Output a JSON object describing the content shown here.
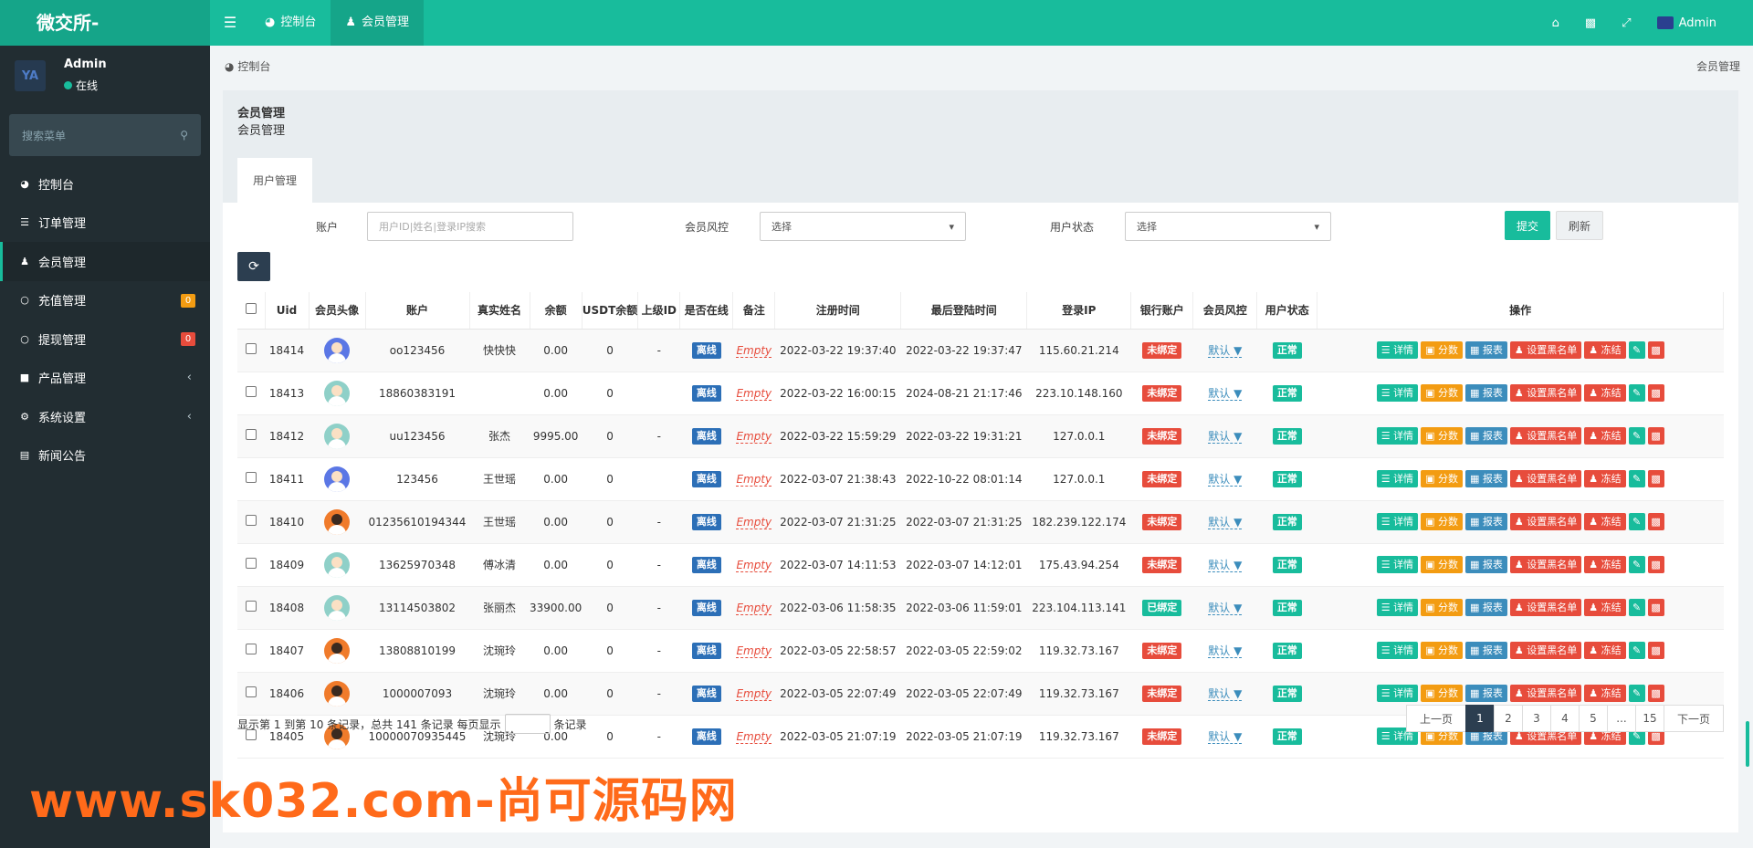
{
  "app": {
    "logo": "微交所-"
  },
  "topnav": {
    "dashboard": "控制台",
    "members": "会员管理"
  },
  "topright": {
    "user": "Admin"
  },
  "sidebar": {
    "user": {
      "name": "Admin",
      "status": "在线",
      "avatar_text": "YA"
    },
    "search_placeholder": "搜索菜单",
    "items": [
      {
        "label": "控制台",
        "icon": "dashboard-icon"
      },
      {
        "label": "订单管理",
        "icon": "list-icon"
      },
      {
        "label": "会员管理",
        "icon": "users-icon"
      },
      {
        "label": "充值管理",
        "icon": "recharge-icon",
        "badge": "0"
      },
      {
        "label": "提现管理",
        "icon": "withdraw-icon",
        "badge": "0"
      },
      {
        "label": "产品管理",
        "icon": "product-icon"
      },
      {
        "label": "系统设置",
        "icon": "settings-icon"
      },
      {
        "label": "新闻公告",
        "icon": "news-icon"
      }
    ]
  },
  "breadcrumb": {
    "left": "控制台",
    "right": "会员管理"
  },
  "panel": {
    "title": "会员管理",
    "subtitle": "会员管理",
    "tab": "用户管理"
  },
  "filters": {
    "account_label": "账户",
    "account_placeholder": "用户ID|姓名|登录IP搜索",
    "risk_label": "会员风控",
    "risk_value": "选择",
    "status_label": "用户状态",
    "status_value": "选择",
    "submit": "提交",
    "refresh": "刷新"
  },
  "table": {
    "headers": [
      "Uid",
      "会员头像",
      "账户",
      "真实姓名",
      "余额",
      "USDT余额",
      "上级ID",
      "是否在线",
      "备注",
      "注册时间",
      "最后登陆时间",
      "登录IP",
      "银行账户",
      "会员风控",
      "用户状态",
      "操作"
    ],
    "rows": [
      {
        "uid": "18414",
        "avatar": "blue",
        "account": "oo123456",
        "name": "快快快",
        "balance": "0.00",
        "usdt": "0",
        "parent": "-",
        "online": "离线",
        "note": "Empty",
        "reg": "2022-03-22 19:37:40",
        "last": "2022-03-22 19:37:47",
        "ip": "115.60.21.214",
        "bank": "未绑定",
        "risk": "默认",
        "status": "正常"
      },
      {
        "uid": "18413",
        "avatar": "teal",
        "account": "18860383191",
        "name": "",
        "balance": "0.00",
        "usdt": "0",
        "parent": "",
        "online": "离线",
        "note": "Empty",
        "reg": "2022-03-22 16:00:15",
        "last": "2024-08-21 21:17:46",
        "ip": "223.10.148.160",
        "bank": "未绑定",
        "risk": "默认",
        "status": "正常"
      },
      {
        "uid": "18412",
        "avatar": "teal",
        "account": "uu123456",
        "name": "张杰",
        "balance": "9995.00",
        "usdt": "0",
        "parent": "-",
        "online": "离线",
        "note": "Empty",
        "reg": "2022-03-22 15:59:29",
        "last": "2022-03-22 19:31:21",
        "ip": "127.0.0.1",
        "bank": "未绑定",
        "risk": "默认",
        "status": "正常"
      },
      {
        "uid": "18411",
        "avatar": "blue",
        "account": "123456",
        "name": "王世瑶",
        "balance": "0.00",
        "usdt": "0",
        "parent": "",
        "online": "离线",
        "note": "Empty",
        "reg": "2022-03-07 21:38:43",
        "last": "2022-10-22 08:01:14",
        "ip": "127.0.0.1",
        "bank": "未绑定",
        "risk": "默认",
        "status": "正常"
      },
      {
        "uid": "18410",
        "avatar": "orange",
        "account": "01235610194344",
        "name": "王世瑶",
        "balance": "0.00",
        "usdt": "0",
        "parent": "-",
        "online": "离线",
        "note": "Empty",
        "reg": "2022-03-07 21:31:25",
        "last": "2022-03-07 21:31:25",
        "ip": "182.239.122.174",
        "bank": "未绑定",
        "risk": "默认",
        "status": "正常"
      },
      {
        "uid": "18409",
        "avatar": "teal",
        "account": "13625970348",
        "name": "傅冰清",
        "balance": "0.00",
        "usdt": "0",
        "parent": "-",
        "online": "离线",
        "note": "Empty",
        "reg": "2022-03-07 14:11:53",
        "last": "2022-03-07 14:12:01",
        "ip": "175.43.94.254",
        "bank": "未绑定",
        "risk": "默认",
        "status": "正常"
      },
      {
        "uid": "18408",
        "avatar": "teal",
        "account": "13114503802",
        "name": "张丽杰",
        "balance": "33900.00",
        "usdt": "0",
        "parent": "-",
        "online": "离线",
        "note": "Empty",
        "reg": "2022-03-06 11:58:35",
        "last": "2022-03-06 11:59:01",
        "ip": "223.104.113.141",
        "bank": "已绑定",
        "risk": "默认",
        "status": "正常"
      },
      {
        "uid": "18407",
        "avatar": "orange",
        "account": "13808810199",
        "name": "沈琬玲",
        "balance": "0.00",
        "usdt": "0",
        "parent": "-",
        "online": "离线",
        "note": "Empty",
        "reg": "2022-03-05 22:58:57",
        "last": "2022-03-05 22:59:02",
        "ip": "119.32.73.167",
        "bank": "未绑定",
        "risk": "默认",
        "status": "正常"
      },
      {
        "uid": "18406",
        "avatar": "orange",
        "account": "1000007093",
        "name": "沈琬玲",
        "balance": "0.00",
        "usdt": "0",
        "parent": "-",
        "online": "离线",
        "note": "Empty",
        "reg": "2022-03-05 22:07:49",
        "last": "2022-03-05 22:07:49",
        "ip": "119.32.73.167",
        "bank": "未绑定",
        "risk": "默认",
        "status": "正常"
      },
      {
        "uid": "18405",
        "avatar": "orange",
        "account": "10000070935445",
        "name": "沈琬玲",
        "balance": "0.00",
        "usdt": "0",
        "parent": "-",
        "online": "离线",
        "note": "Empty",
        "reg": "2022-03-05 21:07:19",
        "last": "2022-03-05 21:07:19",
        "ip": "119.32.73.167",
        "bank": "未绑定",
        "risk": "默认",
        "status": "正常"
      }
    ],
    "actions": {
      "detail": "详情",
      "score": "分数",
      "report": "报表",
      "blacklist": "设置黑名单",
      "freeze": "冻结"
    }
  },
  "pagination": {
    "info_prefix": "显示第 1 到第 10 条记录，总共 141 条记录 每页显示",
    "info_suffix": "条记录",
    "prev": "上一页",
    "pages": [
      "1",
      "2",
      "3",
      "4",
      "5",
      "...",
      "15"
    ],
    "next": "下一页"
  },
  "watermark": "www.sk032.com-尚可源码网"
}
